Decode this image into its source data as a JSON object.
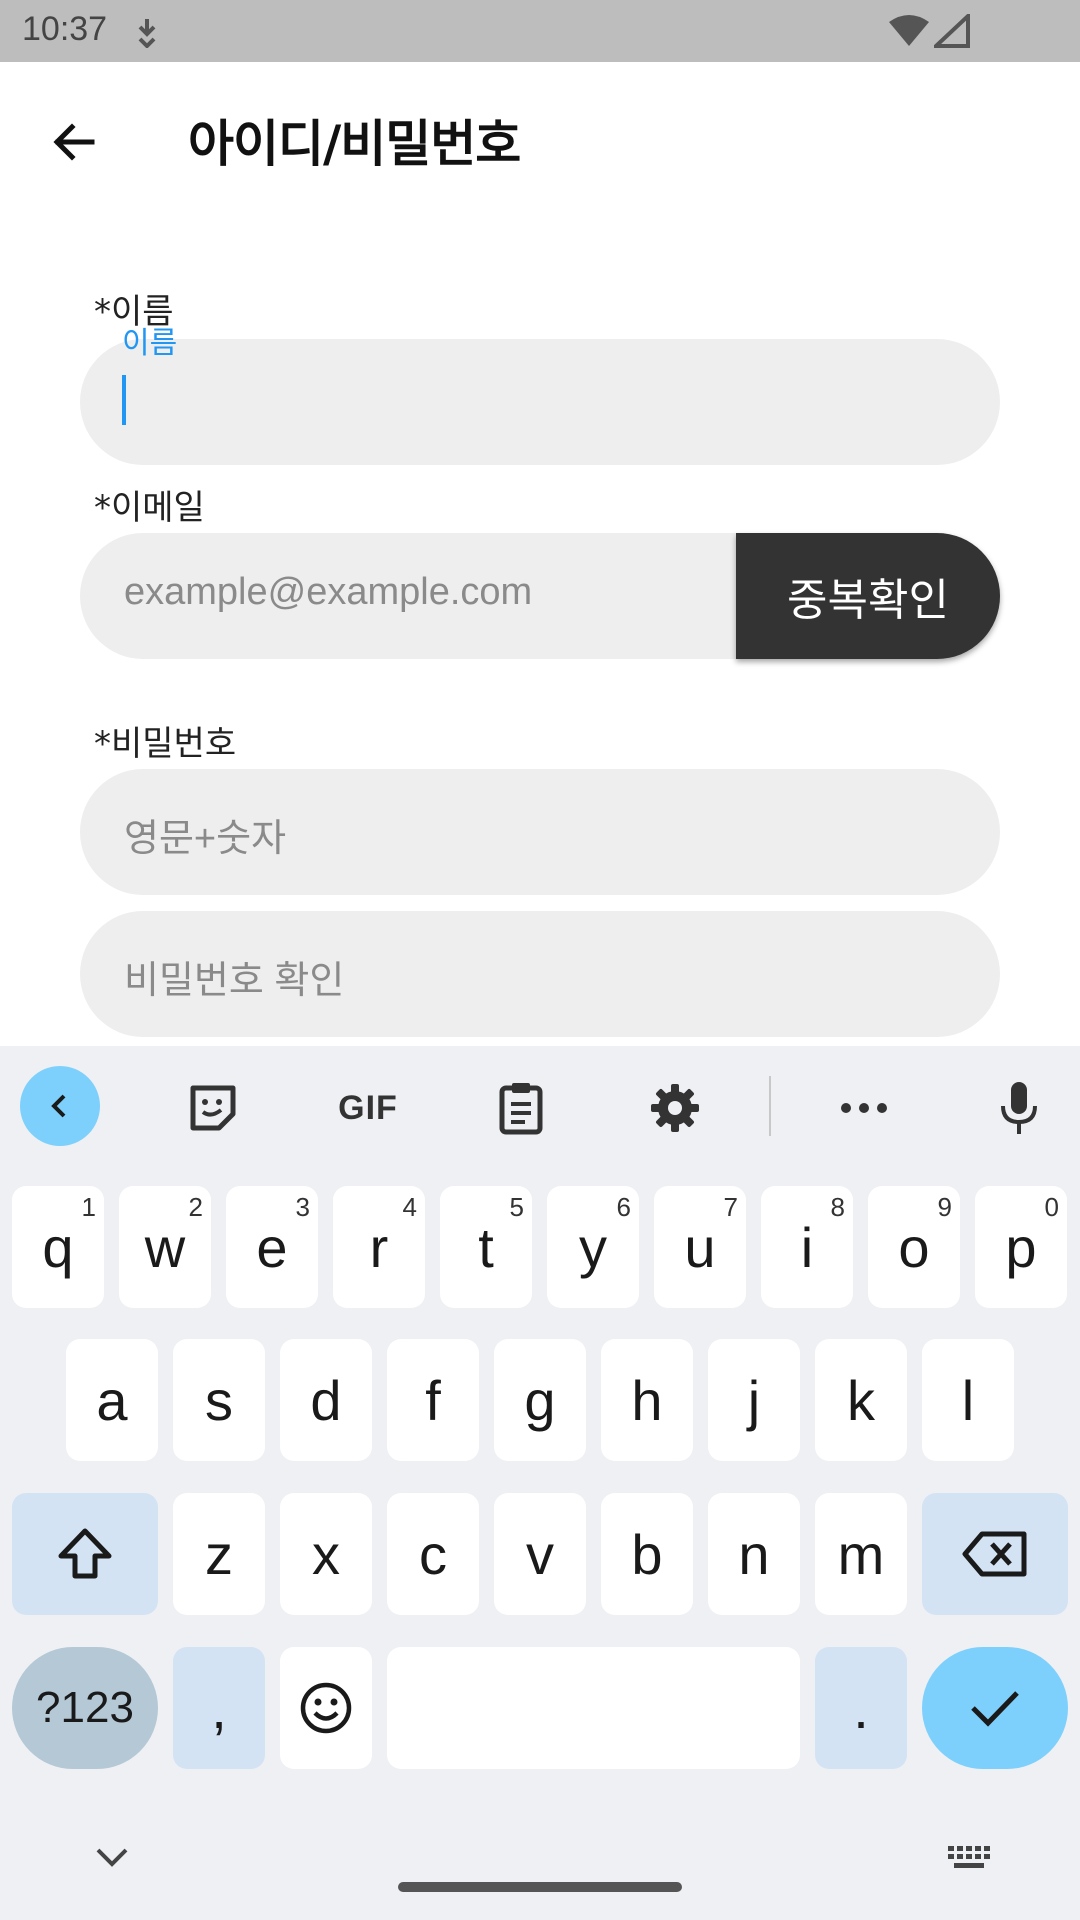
{
  "status_bar": {
    "time": "10:37",
    "download_icon": "download-icon",
    "wifi_icon": "wifi-icon",
    "signal_icon": "signal-icon"
  },
  "app_bar": {
    "back_icon": "arrow-back-icon",
    "title": "아이디/비밀번호"
  },
  "form": {
    "name": {
      "label": "*이름",
      "floating_label": "이름",
      "value": ""
    },
    "email": {
      "label": "*이메일",
      "placeholder": "example@example.com",
      "button_label": "중복확인"
    },
    "password": {
      "label": "*비밀번호",
      "placeholder": "영문+숫자"
    },
    "password_confirm": {
      "placeholder": "비밀번호 확인"
    }
  },
  "keyboard": {
    "toolbar": {
      "gif_label": "GIF"
    },
    "row1": [
      {
        "k": "q",
        "h": "1"
      },
      {
        "k": "w",
        "h": "2"
      },
      {
        "k": "e",
        "h": "3"
      },
      {
        "k": "r",
        "h": "4"
      },
      {
        "k": "t",
        "h": "5"
      },
      {
        "k": "y",
        "h": "6"
      },
      {
        "k": "u",
        "h": "7"
      },
      {
        "k": "i",
        "h": "8"
      },
      {
        "k": "o",
        "h": "9"
      },
      {
        "k": "p",
        "h": "0"
      }
    ],
    "row2": [
      "a",
      "s",
      "d",
      "f",
      "g",
      "h",
      "j",
      "k",
      "l"
    ],
    "row3": [
      "z",
      "x",
      "c",
      "v",
      "b",
      "n",
      "m"
    ],
    "symbols_label": "?123",
    "comma_label": ",",
    "period_label": "."
  },
  "colors": {
    "accent": "#2196f3",
    "button_dark": "#333333",
    "field_bg": "#eeeeee",
    "keyboard_bg": "#eff0f4",
    "enter_key": "#7dd0fb"
  }
}
